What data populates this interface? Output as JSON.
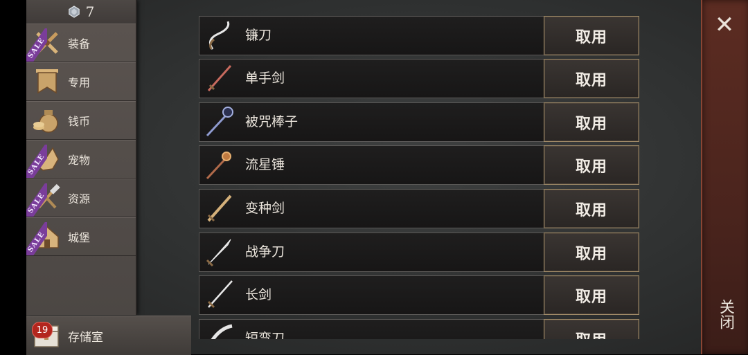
{
  "currency": {
    "amount": "7",
    "icon": "gem-icon"
  },
  "sidebar": {
    "categories": [
      {
        "label": "装备",
        "icon": "crossed-swords-icon",
        "sale": "SALE"
      },
      {
        "label": "专用",
        "icon": "banner-icon",
        "sale": ""
      },
      {
        "label": "钱币",
        "icon": "coin-bag-icon",
        "sale": ""
      },
      {
        "label": "宠物",
        "icon": "pet-icon",
        "sale": "SALE"
      },
      {
        "label": "资源",
        "icon": "tools-icon",
        "sale": "SALE"
      },
      {
        "label": "城堡",
        "icon": "castle-icon",
        "sale": "SALE"
      }
    ],
    "storage": {
      "label": "存储室",
      "badge": "19",
      "icon": "chest-icon"
    }
  },
  "items": [
    {
      "name": "镰刀",
      "button": "取用",
      "icon": "scythe-icon"
    },
    {
      "name": "单手剑",
      "button": "取用",
      "icon": "one-handed-sword-icon"
    },
    {
      "name": "被咒棒子",
      "button": "取用",
      "icon": "cursed-mace-icon"
    },
    {
      "name": "流星锤",
      "button": "取用",
      "icon": "morning-star-icon"
    },
    {
      "name": "变种剑",
      "button": "取用",
      "icon": "variant-sword-icon"
    },
    {
      "name": "战争刀",
      "button": "取用",
      "icon": "war-blade-icon"
    },
    {
      "name": "长剑",
      "button": "取用",
      "icon": "long-sword-icon"
    },
    {
      "name": "短弯刀",
      "button": "取用",
      "icon": "scimitar-icon"
    }
  ],
  "close": {
    "label": "关闭",
    "icon": "close-icon"
  },
  "colors": {
    "button_border": "#a08a67",
    "sale_ribbon": "#7a3d9a",
    "close_panel": "#5c2c22",
    "badge": "#b3261e"
  }
}
